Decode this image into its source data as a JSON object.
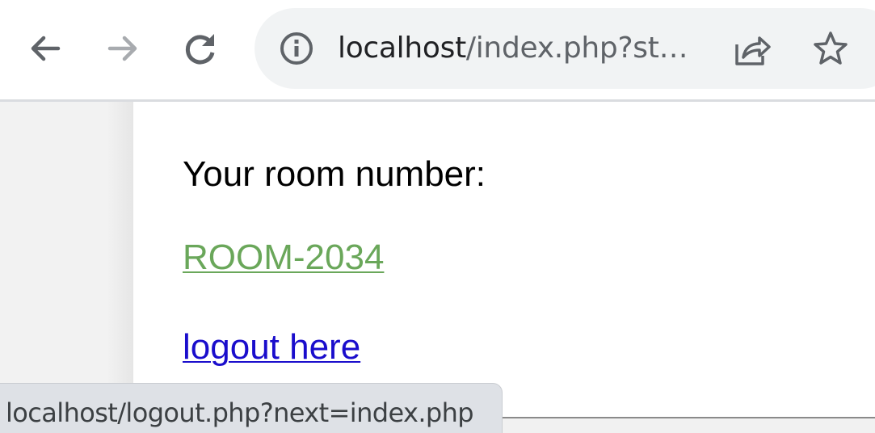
{
  "browser": {
    "url_host": "localhost",
    "url_rest": "/index.php?st…",
    "status_bar_url": "localhost/logout.php?next=index.php",
    "icons": {
      "back": "arrow-left-icon",
      "forward": "arrow-right-icon",
      "reload": "reload-icon",
      "site_info": "info-circle-icon",
      "share": "share-icon",
      "bookmark": "star-icon"
    }
  },
  "page": {
    "room_label": "Your room number:",
    "room_value": "ROOM-2034",
    "logout_link": "logout here"
  },
  "colors": {
    "room_link": "#6aa75a",
    "logout_link": "#1a0dcc",
    "toolbar_icon": "#5f6368",
    "toolbar_icon_disabled": "#a8abaf",
    "omnibox_bg": "#f1f3f4",
    "status_bubble_bg": "#dee1e6"
  }
}
